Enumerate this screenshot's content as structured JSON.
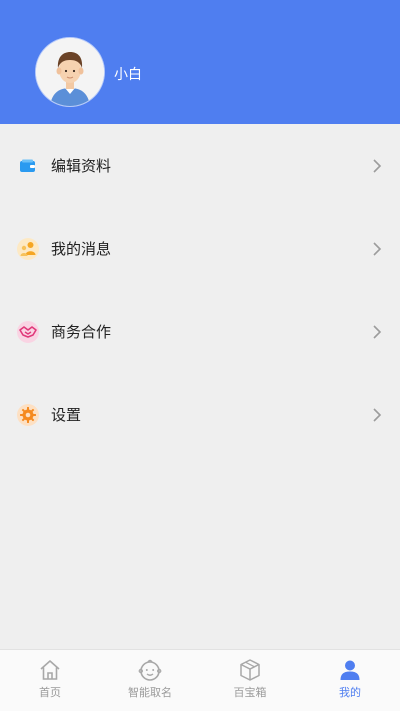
{
  "colors": {
    "header_bg": "#4f7ef0",
    "page_bg": "#efefef",
    "accent": "#4f7ef0",
    "tab_inactive": "#9a9a9a"
  },
  "profile": {
    "name": "小白",
    "avatar_icon": "user-avatar"
  },
  "menu": {
    "items": [
      {
        "label": "编辑资料",
        "icon": "wallet-icon",
        "color": "#2a9af0"
      },
      {
        "label": "我的消息",
        "icon": "people-icon",
        "color": "#f5a623"
      },
      {
        "label": "商务合作",
        "icon": "handshake-icon",
        "color": "#e0397a"
      },
      {
        "label": "设置",
        "icon": "gear-icon",
        "color": "#f58a1f"
      }
    ]
  },
  "tabbar": {
    "items": [
      {
        "label": "首页",
        "icon": "home-icon",
        "active": false
      },
      {
        "label": "智能取名",
        "icon": "baby-face-icon",
        "active": false
      },
      {
        "label": "百宝箱",
        "icon": "box-icon",
        "active": false
      },
      {
        "label": "我的",
        "icon": "person-icon",
        "active": true
      }
    ]
  }
}
